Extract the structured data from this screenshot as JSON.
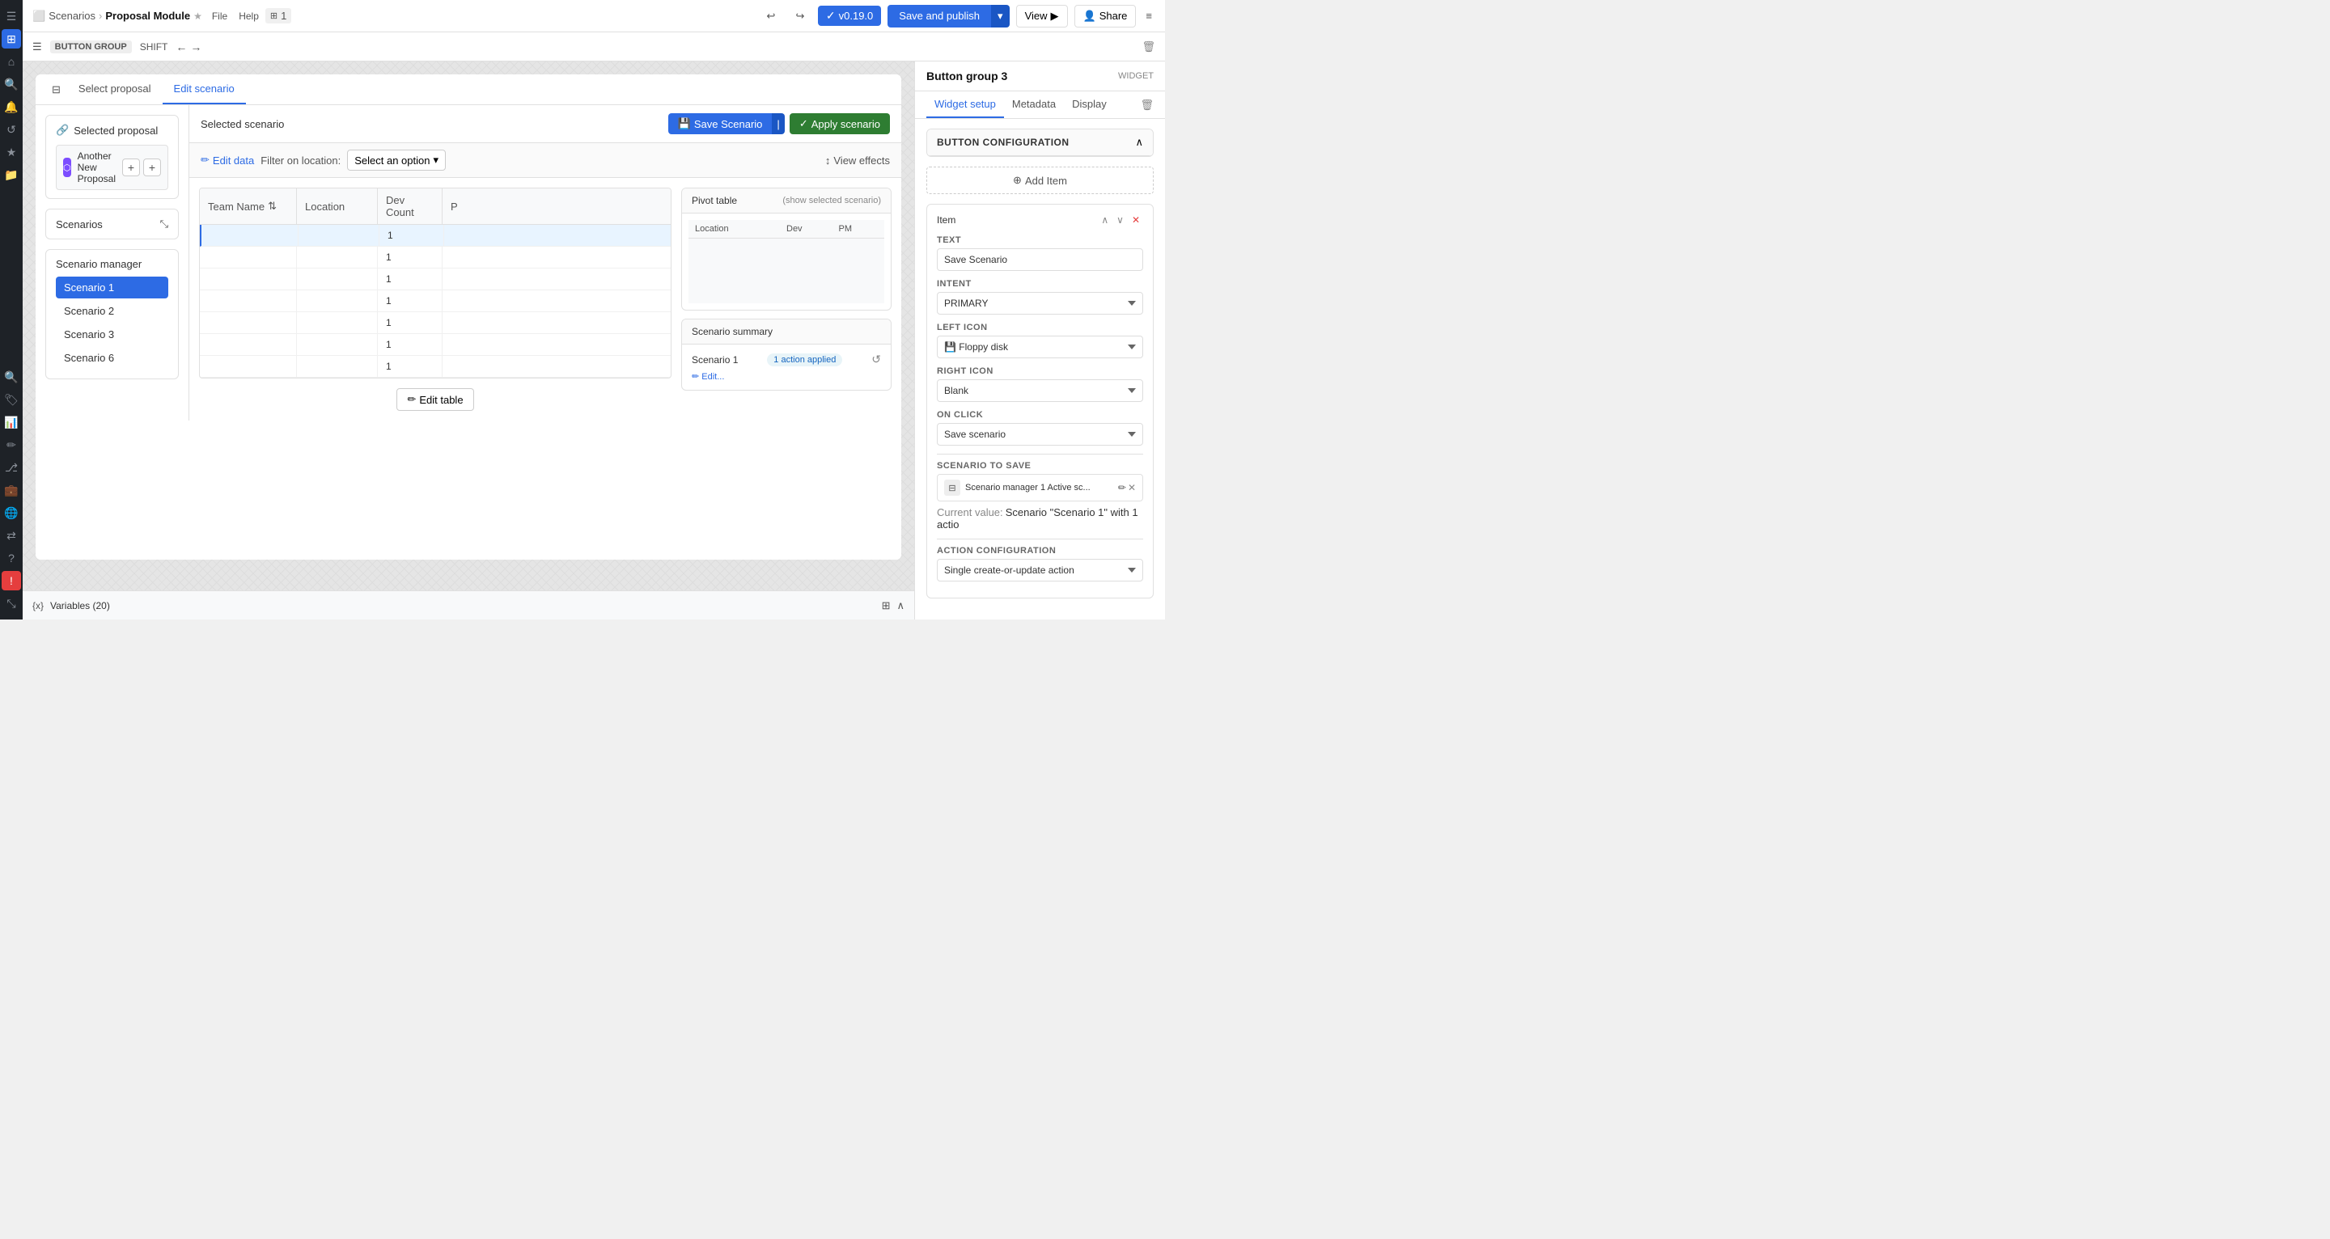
{
  "app": {
    "title": "Proposal Module",
    "breadcrumb": "Scenarios",
    "star": "★",
    "version": "v0.19.0"
  },
  "top_bar": {
    "file_label": "File",
    "help_label": "Help",
    "page_num": "1",
    "save_publish_label": "Save and publish",
    "view_label": "View",
    "share_label": "Share"
  },
  "secondary_bar": {
    "group_label": "BUTTON GROUP",
    "shift_label": "SHIFT"
  },
  "config_panel": {
    "title": "Button group 3",
    "widget_label": "WIDGET",
    "tabs": [
      "Widget setup",
      "Metadata",
      "Display"
    ],
    "active_tab": "Widget setup",
    "section_title": "BUTTON CONFIGURATION",
    "add_item_label": "Add Item",
    "item_title": "Item",
    "text_label": "TEXT",
    "text_value": "Save Scenario",
    "intent_label": "INTENT",
    "intent_value": "PRIMARY",
    "left_icon_label": "LEFT ICON",
    "left_icon_value": "Floppy disk",
    "right_icon_label": "RIGHT ICON",
    "right_icon_value": "Blank",
    "on_click_label": "ON CLICK",
    "on_click_value": "Save scenario",
    "scenario_to_save_label": "SCENARIO TO SAVE",
    "scenario_name": "Scenario manager 1 Active sc...",
    "current_value_label": "Current value:",
    "current_value": "Scenario \"Scenario 1\" with 1 actio",
    "action_config_label": "ACTION CONFIGURATION",
    "action_config_value": "Single create-or-update action"
  },
  "widget": {
    "tabs": [
      {
        "label": "Select proposal"
      },
      {
        "label": "Edit scenario"
      }
    ],
    "active_tab": "Edit scenario",
    "selected_proposal_label": "Selected proposal",
    "proposal_name": "Another New Proposal",
    "scenarios_label": "Scenarios",
    "scenario_manager_label": "Scenario manager",
    "scenarios": [
      {
        "name": "Scenario 1",
        "active": true
      },
      {
        "name": "Scenario 2",
        "active": false
      },
      {
        "name": "Scenario 3",
        "active": false
      },
      {
        "name": "Scenario 6",
        "active": false
      }
    ],
    "selected_scenario_label": "Selected scenario",
    "save_scenario_btn": "Save Scenario",
    "apply_scenario_btn": "Apply scenario",
    "edit_data_label": "Edit data",
    "filter_location_label": "Filter on location:",
    "select_option_label": "Select an option",
    "view_effects_label": "View effects",
    "table_headers": [
      "Team Name",
      "Location",
      "Dev Count",
      "P"
    ],
    "table_rows": [
      {
        "team": "",
        "location": "",
        "dev": "1",
        "p": ""
      },
      {
        "team": "",
        "location": "",
        "dev": "1",
        "p": ""
      },
      {
        "team": "",
        "location": "",
        "dev": "1",
        "p": ""
      },
      {
        "team": "",
        "location": "",
        "dev": "1",
        "p": ""
      },
      {
        "team": "",
        "location": "",
        "dev": "1",
        "p": ""
      },
      {
        "team": "",
        "location": "",
        "dev": "1",
        "p": ""
      },
      {
        "team": "",
        "location": "",
        "dev": "1",
        "p": ""
      }
    ],
    "edit_table_btn": "Edit table",
    "pivot_table_title": "Pivot table",
    "pivot_subtitle": "(show selected scenario)",
    "pivot_headers": [
      "Location",
      "Dev",
      "PM"
    ],
    "scenario_summary_title": "Scenario summary",
    "scenario_summary_name": "Scenario 1",
    "action_applied": "1 action applied",
    "variables_label": "Variables (20)"
  }
}
